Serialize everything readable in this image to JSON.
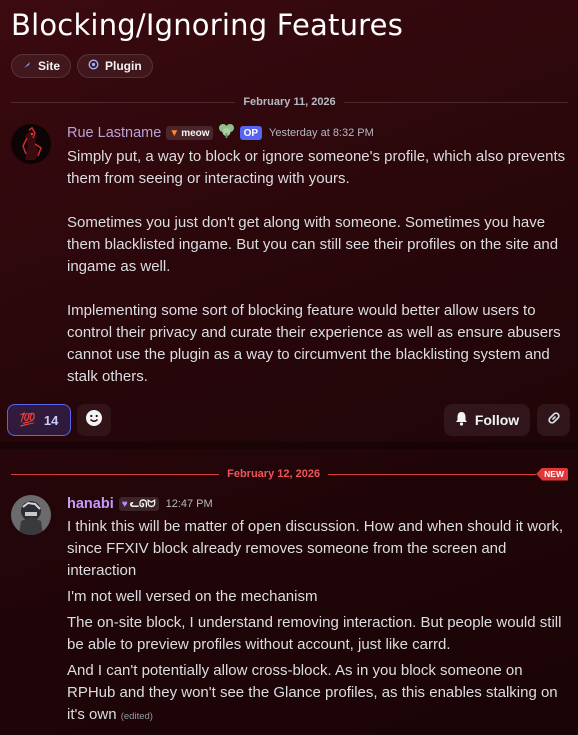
{
  "title": "Blocking/Ignoring Features",
  "tags": [
    {
      "label": "Site",
      "icon": "feather-icon"
    },
    {
      "label": "Plugin",
      "icon": "plugin-icon"
    }
  ],
  "colors": {
    "accent": "#5865f2",
    "new": "#e0383a",
    "author1": "#b8a4d6",
    "author2": "#c39bff"
  },
  "messages": [
    {
      "date": "February 11, 2026",
      "author": "Rue Lastname",
      "tag": "meow",
      "op": "OP",
      "time": "Yesterday at 8:32 PM",
      "paragraphs": [
        "Simply put, a way to block or ignore someone's profile, which also prevents them from seeing or interacting with yours.",
        "Sometimes you just don't get along with someone. Sometimes you have them blacklisted ingame. But you can still see their profiles on the site and ingame as well.",
        "Implementing some sort of blocking feature would better allow users to control their privacy and curate their experience as well as ensure abusers cannot use the plugin as a way to circumvent the blacklisting system and stalk others."
      ],
      "reaction": {
        "emoji": "💯",
        "count": "14"
      },
      "follow_label": "Follow"
    },
    {
      "date": "February 12, 2026",
      "new_label": "NEW",
      "author": "hanabi",
      "tag": "ᓚᘏᗢ",
      "time": "12:47 PM",
      "paragraphs": [
        "I think this will be matter of open discussion. How and when should it work, since FFXIV block already removes someone from the screen and interaction",
        "I'm not well versed on the mechanism",
        "The on-site block, I understand removing interaction. But people would still be able to preview profiles without account, just like carrd.",
        "And I can't potentially allow cross-block. As in you block someone on RPHub and they won't see the Glance profiles, as this enables stalking on it's own"
      ],
      "edited": "(edited)"
    }
  ]
}
